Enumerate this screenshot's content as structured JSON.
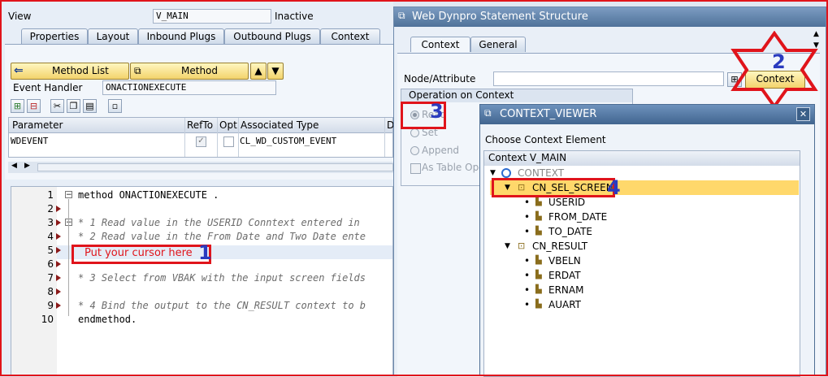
{
  "main": {
    "view_label": "View",
    "view_value": "V_MAIN",
    "status": "Inactive",
    "tabs": [
      {
        "label": "Properties"
      },
      {
        "label": "Layout"
      },
      {
        "label": "Inbound Plugs"
      },
      {
        "label": "Outbound Plugs"
      },
      {
        "label": "Context"
      }
    ],
    "method_list_button": "Method List",
    "method_button": "Method",
    "event_handler_label": "Event Handler",
    "event_handler_value": "ONACTIONEXECUTE",
    "param_table": {
      "headers": [
        "Parameter",
        "RefTo",
        "Opt",
        "Associated Type",
        "D"
      ],
      "rows": [
        {
          "parameter": "WDEVENT",
          "refto": true,
          "opt": false,
          "type": "CL_WD_CUSTOM_EVENT"
        }
      ]
    },
    "code_lines": [
      {
        "num": "1",
        "text": "method ONACTIONEXECUTE ."
      },
      {
        "num": "2",
        "text": ""
      },
      {
        "num": "3",
        "text": "* 1 Read value in the USERID Conntext entered in"
      },
      {
        "num": "4",
        "text": "* 2 Read value in the From Date and Two Date ente"
      },
      {
        "num": "5",
        "text": ""
      },
      {
        "num": "6",
        "text": ""
      },
      {
        "num": "7",
        "text": "* 3 Select from VBAK with the input screen fields"
      },
      {
        "num": "8",
        "text": ""
      },
      {
        "num": "9",
        "text": "* 4 Bind the output to the CN_RESULT context to b"
      },
      {
        "num": "10",
        "text": "endmethod."
      }
    ],
    "cursor_hint": "Put your cursor here"
  },
  "statement_dialog": {
    "title": "Web Dynpro Statement Structure",
    "tabs": [
      {
        "label": "Context"
      },
      {
        "label": "General"
      }
    ],
    "node_attribute_label": "Node/Attribute",
    "node_attribute_value": "",
    "context_button": "Context",
    "operation_group_label": "Operation on Context",
    "operations": [
      {
        "label": "Read",
        "selected": true
      },
      {
        "label": "Set",
        "selected": false
      },
      {
        "label": "Append",
        "selected": false
      }
    ],
    "as_table_label": "As Table Ope"
  },
  "context_viewer": {
    "title": "CONTEXT_VIEWER",
    "close_icon": "close-icon",
    "choose_label": "Choose Context Element",
    "tree_header": "Context V_MAIN",
    "root": "CONTEXT",
    "nodes": [
      {
        "label": "CN_SEL_SCREEN",
        "highlighted": true,
        "attrs": [
          "USERID",
          "FROM_DATE",
          "TO_DATE"
        ]
      },
      {
        "label": "CN_RESULT",
        "highlighted": false,
        "attrs": [
          "VBELN",
          "ERDAT",
          "ERNAM",
          "AUART"
        ]
      }
    ]
  },
  "annotations": {
    "step1": "1",
    "step2": "2",
    "step3": "3",
    "step4": "4"
  },
  "colors": {
    "accent_red": "#e0141b",
    "step_number_blue": "#2a3bbf",
    "dialog_title_bar": "#5a7fa8",
    "highlight_yellow": "#ffd86b"
  }
}
